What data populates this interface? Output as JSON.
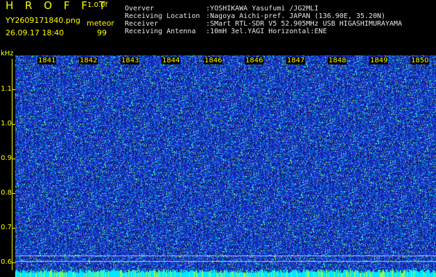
{
  "header": {
    "app_title": "H R O F F T",
    "version": "1.0.0f",
    "filename": "YY2609171840.png",
    "mode": "meteor",
    "timestamp": "26.09.17 18:40",
    "count": "99"
  },
  "info": [
    {
      "key": "Overver",
      "value": ":YOSHIKAWA Yasufumi /JG2MLI"
    },
    {
      "key": "Receiving Location",
      "value": ":Nagoya Aichi-pref. JAPAN (136.90E, 35.20N)"
    },
    {
      "key": "Receiver",
      "value": ":SMart RTL-SDR V5 52.905MHz USB HIGASHIMURAYAMA"
    },
    {
      "key": "Receiving Antenna",
      "value": ":10mH 3el.YAGI Horizontal:ENE"
    }
  ],
  "axis": {
    "unit": "kHz",
    "y_labels": [
      "1.1",
      "1.0",
      "0.9",
      "0.8",
      "0.7",
      "0.6"
    ],
    "x_labels": [
      "1841",
      "1842",
      "1843",
      "1844",
      "1846",
      "1846",
      "1847",
      "1848",
      "1849",
      "1850"
    ]
  },
  "colors": {
    "background": "#000000",
    "label_yellow": "#ffff00",
    "spectrum_blue": "#1f2fd0",
    "noise_cyan": "#00e0ff",
    "noise_green": "#7cff60"
  }
}
